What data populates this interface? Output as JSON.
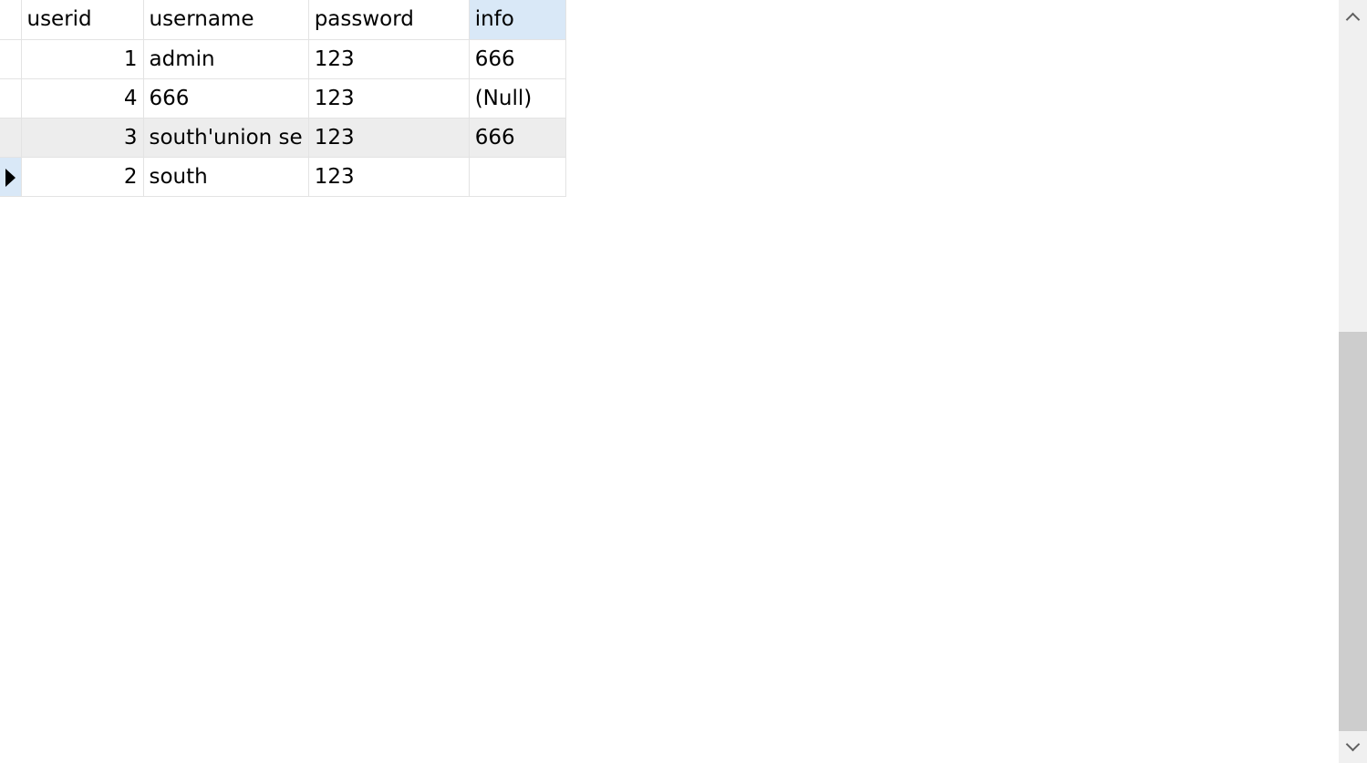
{
  "table": {
    "columns": [
      "userid",
      "username",
      "password",
      "info"
    ],
    "rows": [
      {
        "userid": "1",
        "username": "admin",
        "password": "123",
        "info": "666"
      },
      {
        "userid": "4",
        "username": "666",
        "password": "123",
        "info": "(Null)"
      },
      {
        "userid": "3",
        "username": "south'union se",
        "password": "123",
        "info": "666"
      },
      {
        "userid": "2",
        "username": "south",
        "password": "123",
        "info": ""
      }
    ],
    "selected_column": "info",
    "current_row": 3
  },
  "colors": {
    "selection": "#d9e8f7",
    "alt_row": "#ededed",
    "null_text": "#a9a9b8"
  }
}
